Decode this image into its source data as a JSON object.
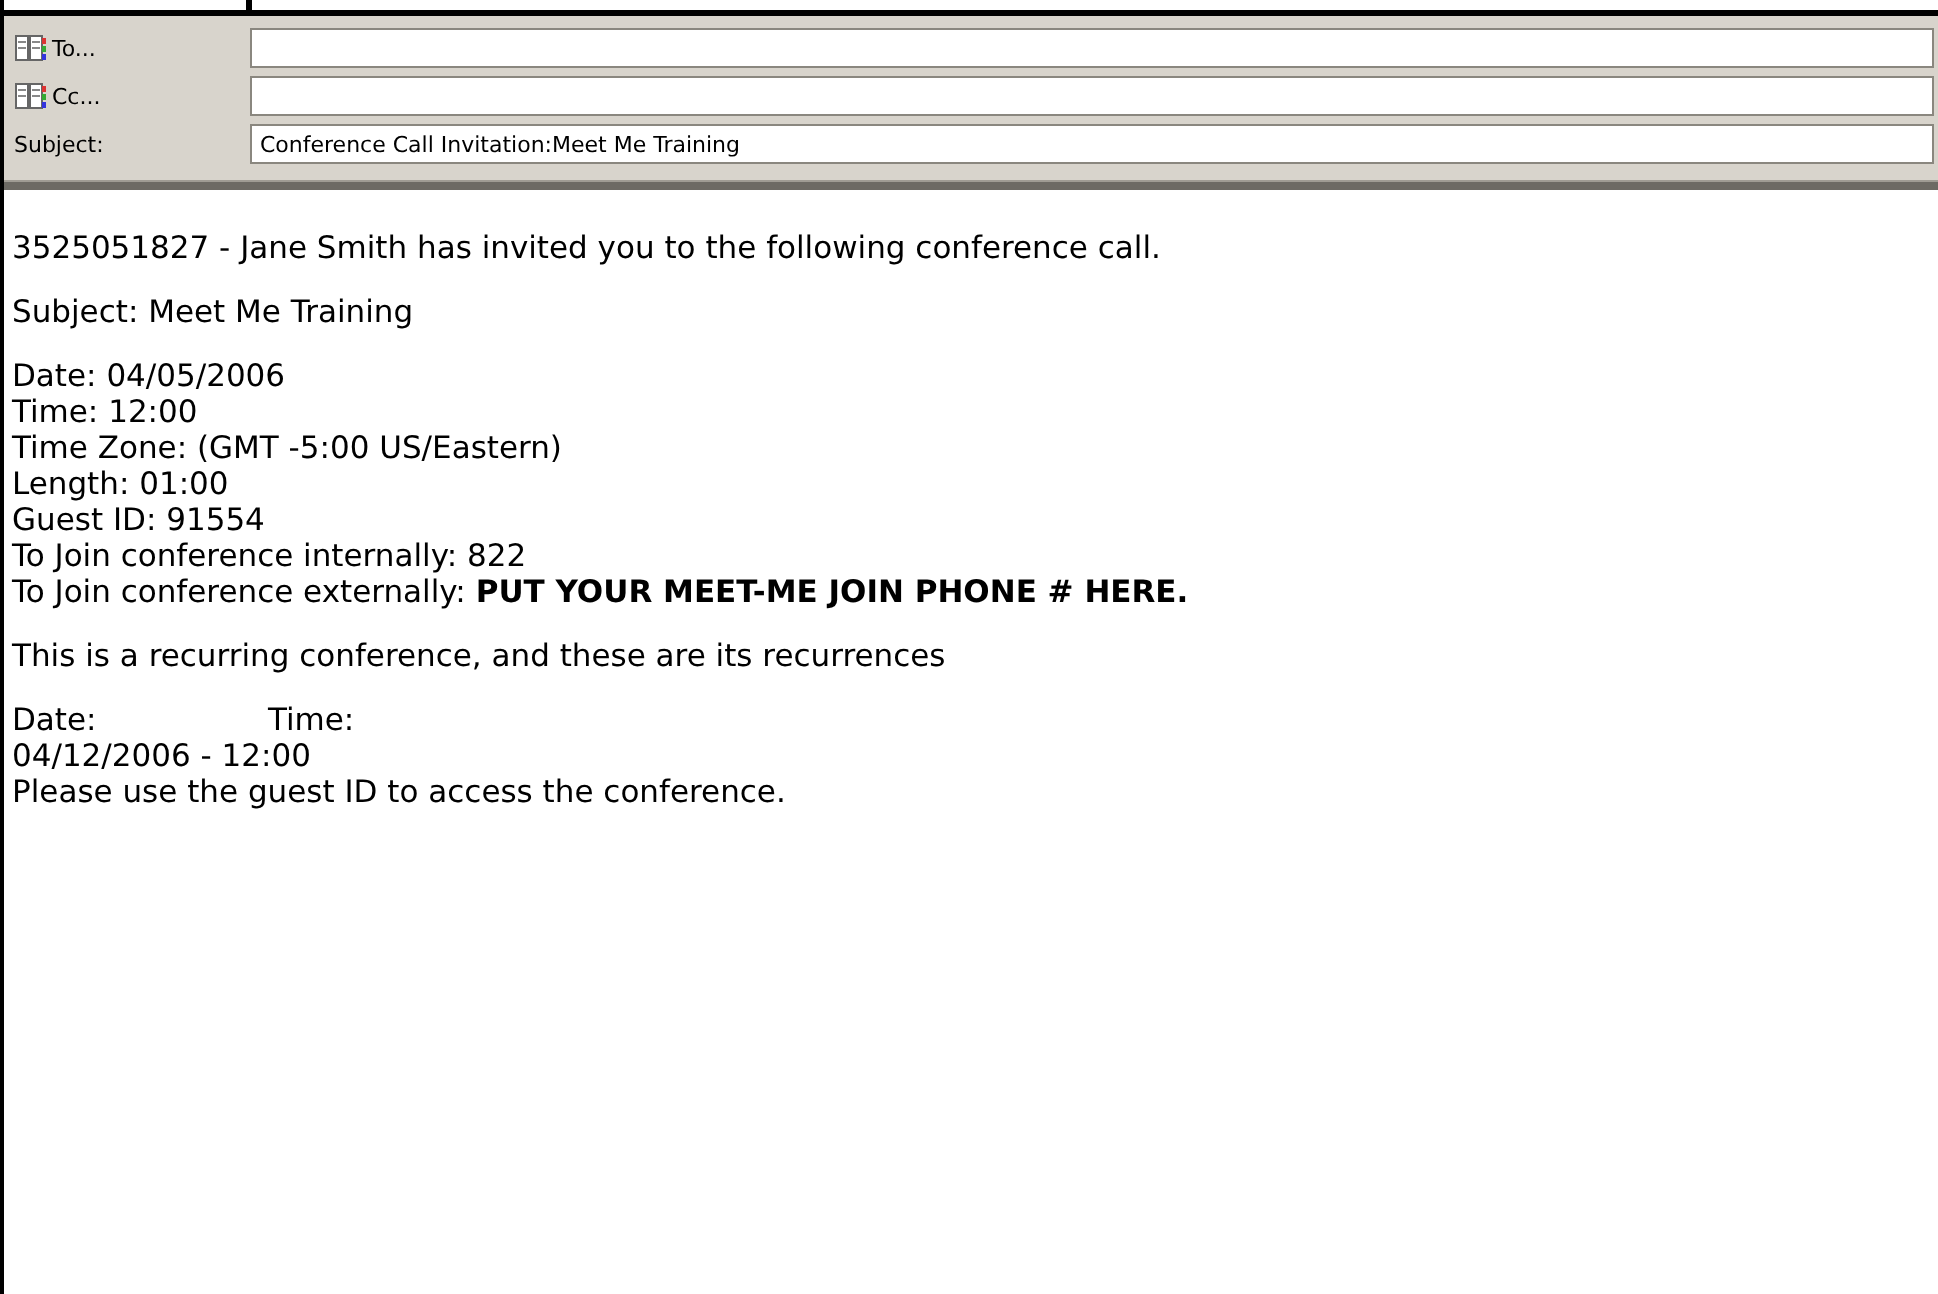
{
  "header": [
    {
      "kind": "address",
      "label": "To..."
    },
    {
      "kind": "address",
      "label": "Cc..."
    },
    {
      "kind": "plain",
      "label": "Subject:",
      "value": "Conference Call Invitation:Meet Me Training"
    }
  ],
  "body": {
    "blocks": [
      {
        "lines": [
          "3525051827 - Jane Smith has invited you to the following conference call."
        ]
      },
      {
        "lines": [
          "Subject: Meet Me Training"
        ]
      },
      {
        "lines": [
          "Date: 04/05/2006",
          "Time: 12:00",
          "Time Zone: (GMT -5:00 US/Eastern)",
          "Length: 01:00",
          "Guest ID: 91554",
          "To Join conference internally: 822",
          "To Join conference externally: **PUT YOUR MEET-ME JOIN PHONE # HERE.**"
        ]
      },
      {
        "lines": [
          "This is a recurring conference, and these are its recurrences"
        ]
      },
      {
        "columns": [
          "Date:",
          "Time:"
        ],
        "lines": [
          "04/12/2006 - 12:00",
          "Please use the guest ID to access the conference."
        ]
      }
    ]
  }
}
